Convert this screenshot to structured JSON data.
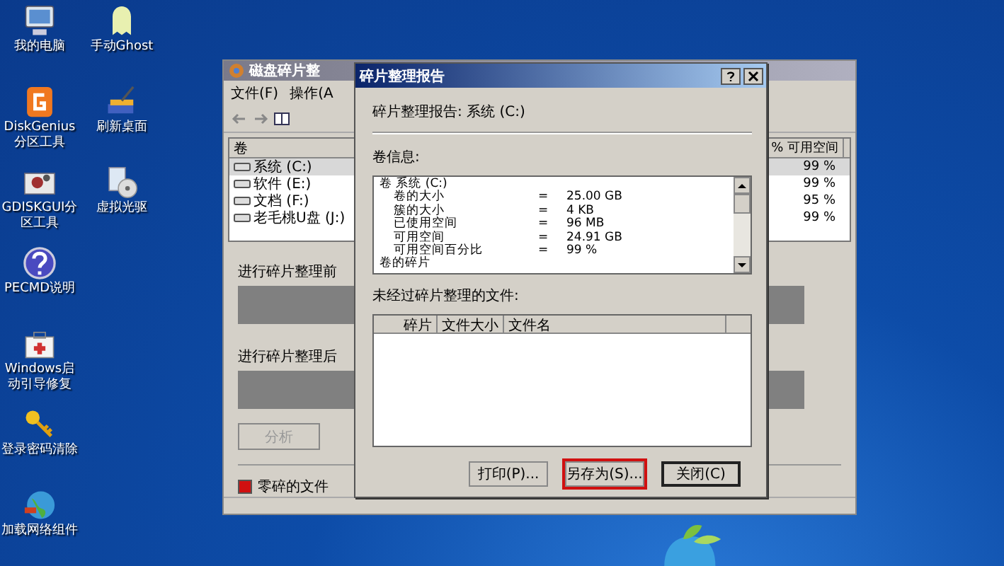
{
  "desktop_columns": [
    [
      {
        "kind": "computer",
        "label": "我的电脑"
      },
      {
        "kind": "partition",
        "label": "DiskGenius分区工具"
      },
      {
        "kind": "gear",
        "label": "GDISKGUI分区工具"
      },
      {
        "kind": "help",
        "label": "PECMD说明"
      },
      {
        "kind": "toolbox",
        "label": "Windows启动引导修复"
      },
      {
        "kind": "key",
        "label": "登录密码清除"
      },
      {
        "kind": "globe",
        "label": "加载网络组件"
      }
    ],
    [
      {
        "kind": "ghost",
        "label": "手动Ghost"
      },
      {
        "kind": "brush",
        "label": "刷新桌面"
      },
      {
        "kind": "disc",
        "label": "虚拟光驱"
      }
    ]
  ],
  "back_window": {
    "title": "磁盘碎片整",
    "menu": [
      "文件(F)",
      "操作(A"
    ],
    "volume_columns": [
      "卷",
      "% 可用空间"
    ],
    "volumes": [
      {
        "name": "系统 (C:)",
        "free": "99 %",
        "selected": true
      },
      {
        "name": "软件 (E:)",
        "free": "99 %",
        "selected": false
      },
      {
        "name": "文档 (F:)",
        "free": "95 %",
        "selected": false
      },
      {
        "name": "老毛桃U盘 (J:)",
        "free": "99 %",
        "selected": false
      }
    ],
    "before_label": "进行碎片整理前",
    "after_label": "进行碎片整理后",
    "analyze_button": {
      "label": "分析",
      "disabled": true
    },
    "legend": [
      {
        "label": "零碎的文件",
        "color": "#d01010"
      }
    ]
  },
  "dialog": {
    "title": "碎片整理报告",
    "heading": "碎片整理报告: 系统 (C:)",
    "info_label": "卷信息:",
    "info_lines": [
      {
        "kind": "heading",
        "label": "卷  系统 (C:)"
      },
      {
        "kind": "row",
        "label": "卷的大小",
        "sign": "=",
        "value": "25.00 GB"
      },
      {
        "kind": "row",
        "label": "簇的大小",
        "sign": "=",
        "value": "4 KB"
      },
      {
        "kind": "row",
        "label": "已使用空间",
        "sign": "=",
        "value": "96 MB"
      },
      {
        "kind": "row",
        "label": "可用空间",
        "sign": "=",
        "value": "24.91 GB"
      },
      {
        "kind": "row",
        "label": "可用空间百分比",
        "sign": "=",
        "value": "99 %"
      },
      {
        "kind": "heading",
        "label": "卷的碎片"
      }
    ],
    "files_label": "未经过碎片整理的文件:",
    "file_columns": [
      "碎片",
      "文件大小",
      "文件名"
    ],
    "buttons": [
      {
        "label": "打印(P)...",
        "highlighted": false,
        "default": false
      },
      {
        "label": "另存为(S)...",
        "highlighted": true,
        "default": false
      },
      {
        "label": "关闭(C)",
        "highlighted": false,
        "default": true
      }
    ]
  }
}
